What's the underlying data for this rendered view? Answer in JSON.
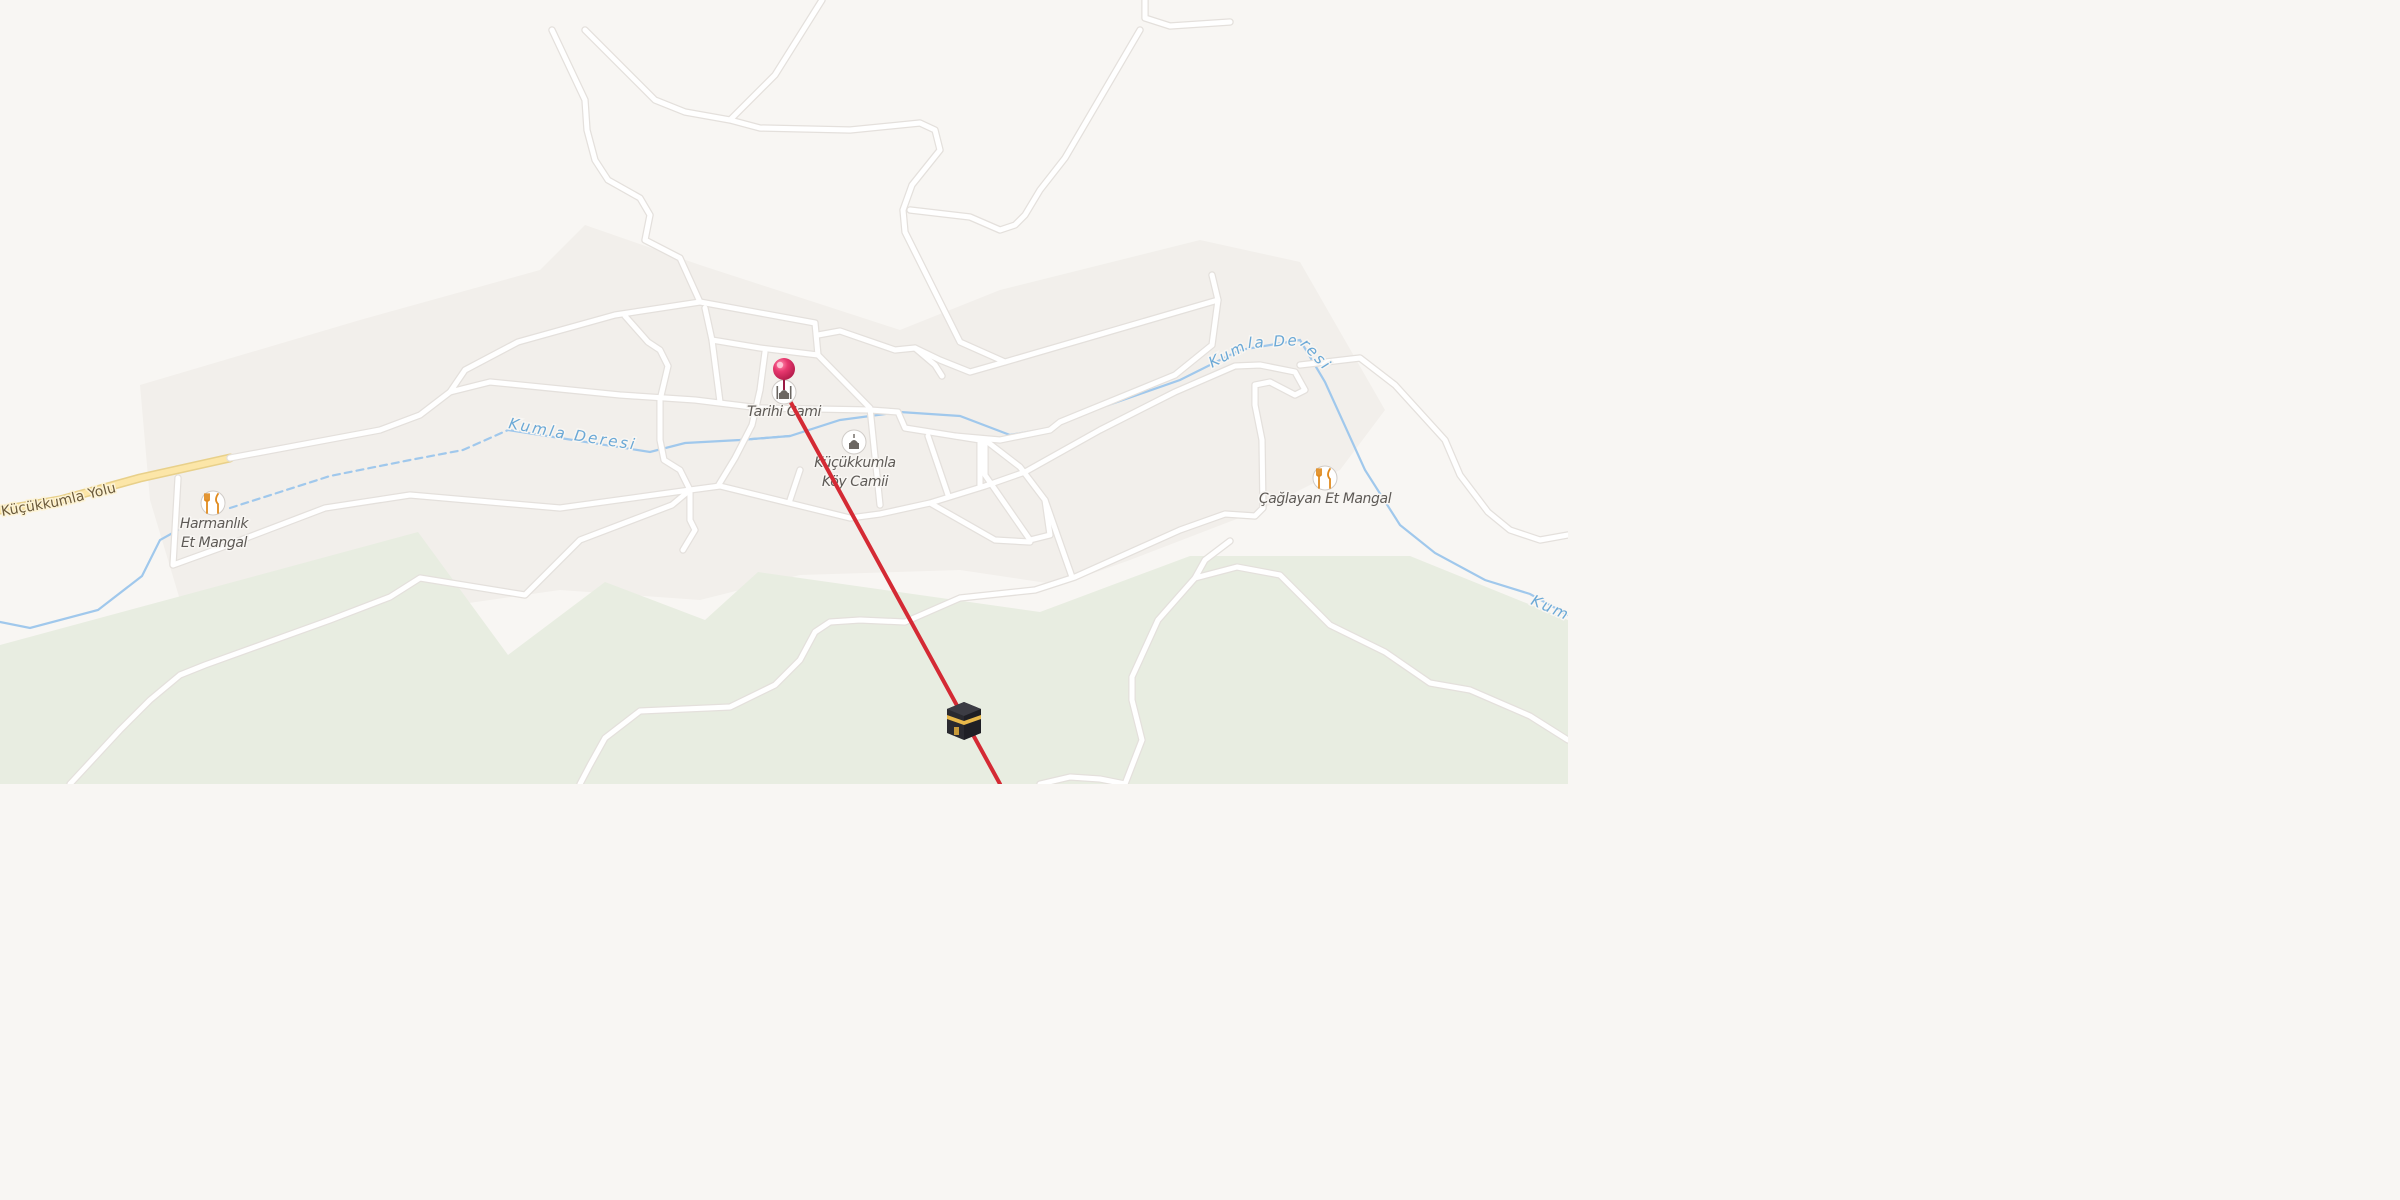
{
  "map": {
    "theme": {
      "land": "#f8f6f3",
      "residential": "#f2efeb",
      "forest": "#e8ede1",
      "water": "#a0c8ec",
      "water_label": "#6aa8d6",
      "road": "#ffffff",
      "road_casing": "#e4e0dc",
      "highway": "#fce6a8",
      "route_line": "#d42a34",
      "pin": "#e8386f"
    },
    "road_labels": {
      "kucukkumla_yolu": "Küçükkumla Yolu"
    },
    "water_labels": {
      "kumla_deresi_west": "Kumla Deresi",
      "kumla_deresi_east": "Kumla Deresi",
      "kumla_deresi_edge": "Kum"
    },
    "pois": {
      "tarihi_cami": {
        "name": "Tarihi Cami",
        "icon": "mosque-icon"
      },
      "kucukkumla_koy_camii": {
        "line1": "Küçükkumla",
        "line2": "Köy Camii",
        "icon": "mosque-icon"
      },
      "harmanlik": {
        "line1": "Harmanlık",
        "line2": "Et Mangal",
        "icon": "restaurant-icon"
      },
      "caglayan": {
        "name": "Çağlayan Et Mangal",
        "icon": "restaurant-icon"
      }
    },
    "markers": {
      "location_pin": {
        "icon": "location-pin-icon"
      },
      "kaaba": {
        "icon": "kaaba-icon",
        "meaning": "qibla"
      }
    }
  }
}
